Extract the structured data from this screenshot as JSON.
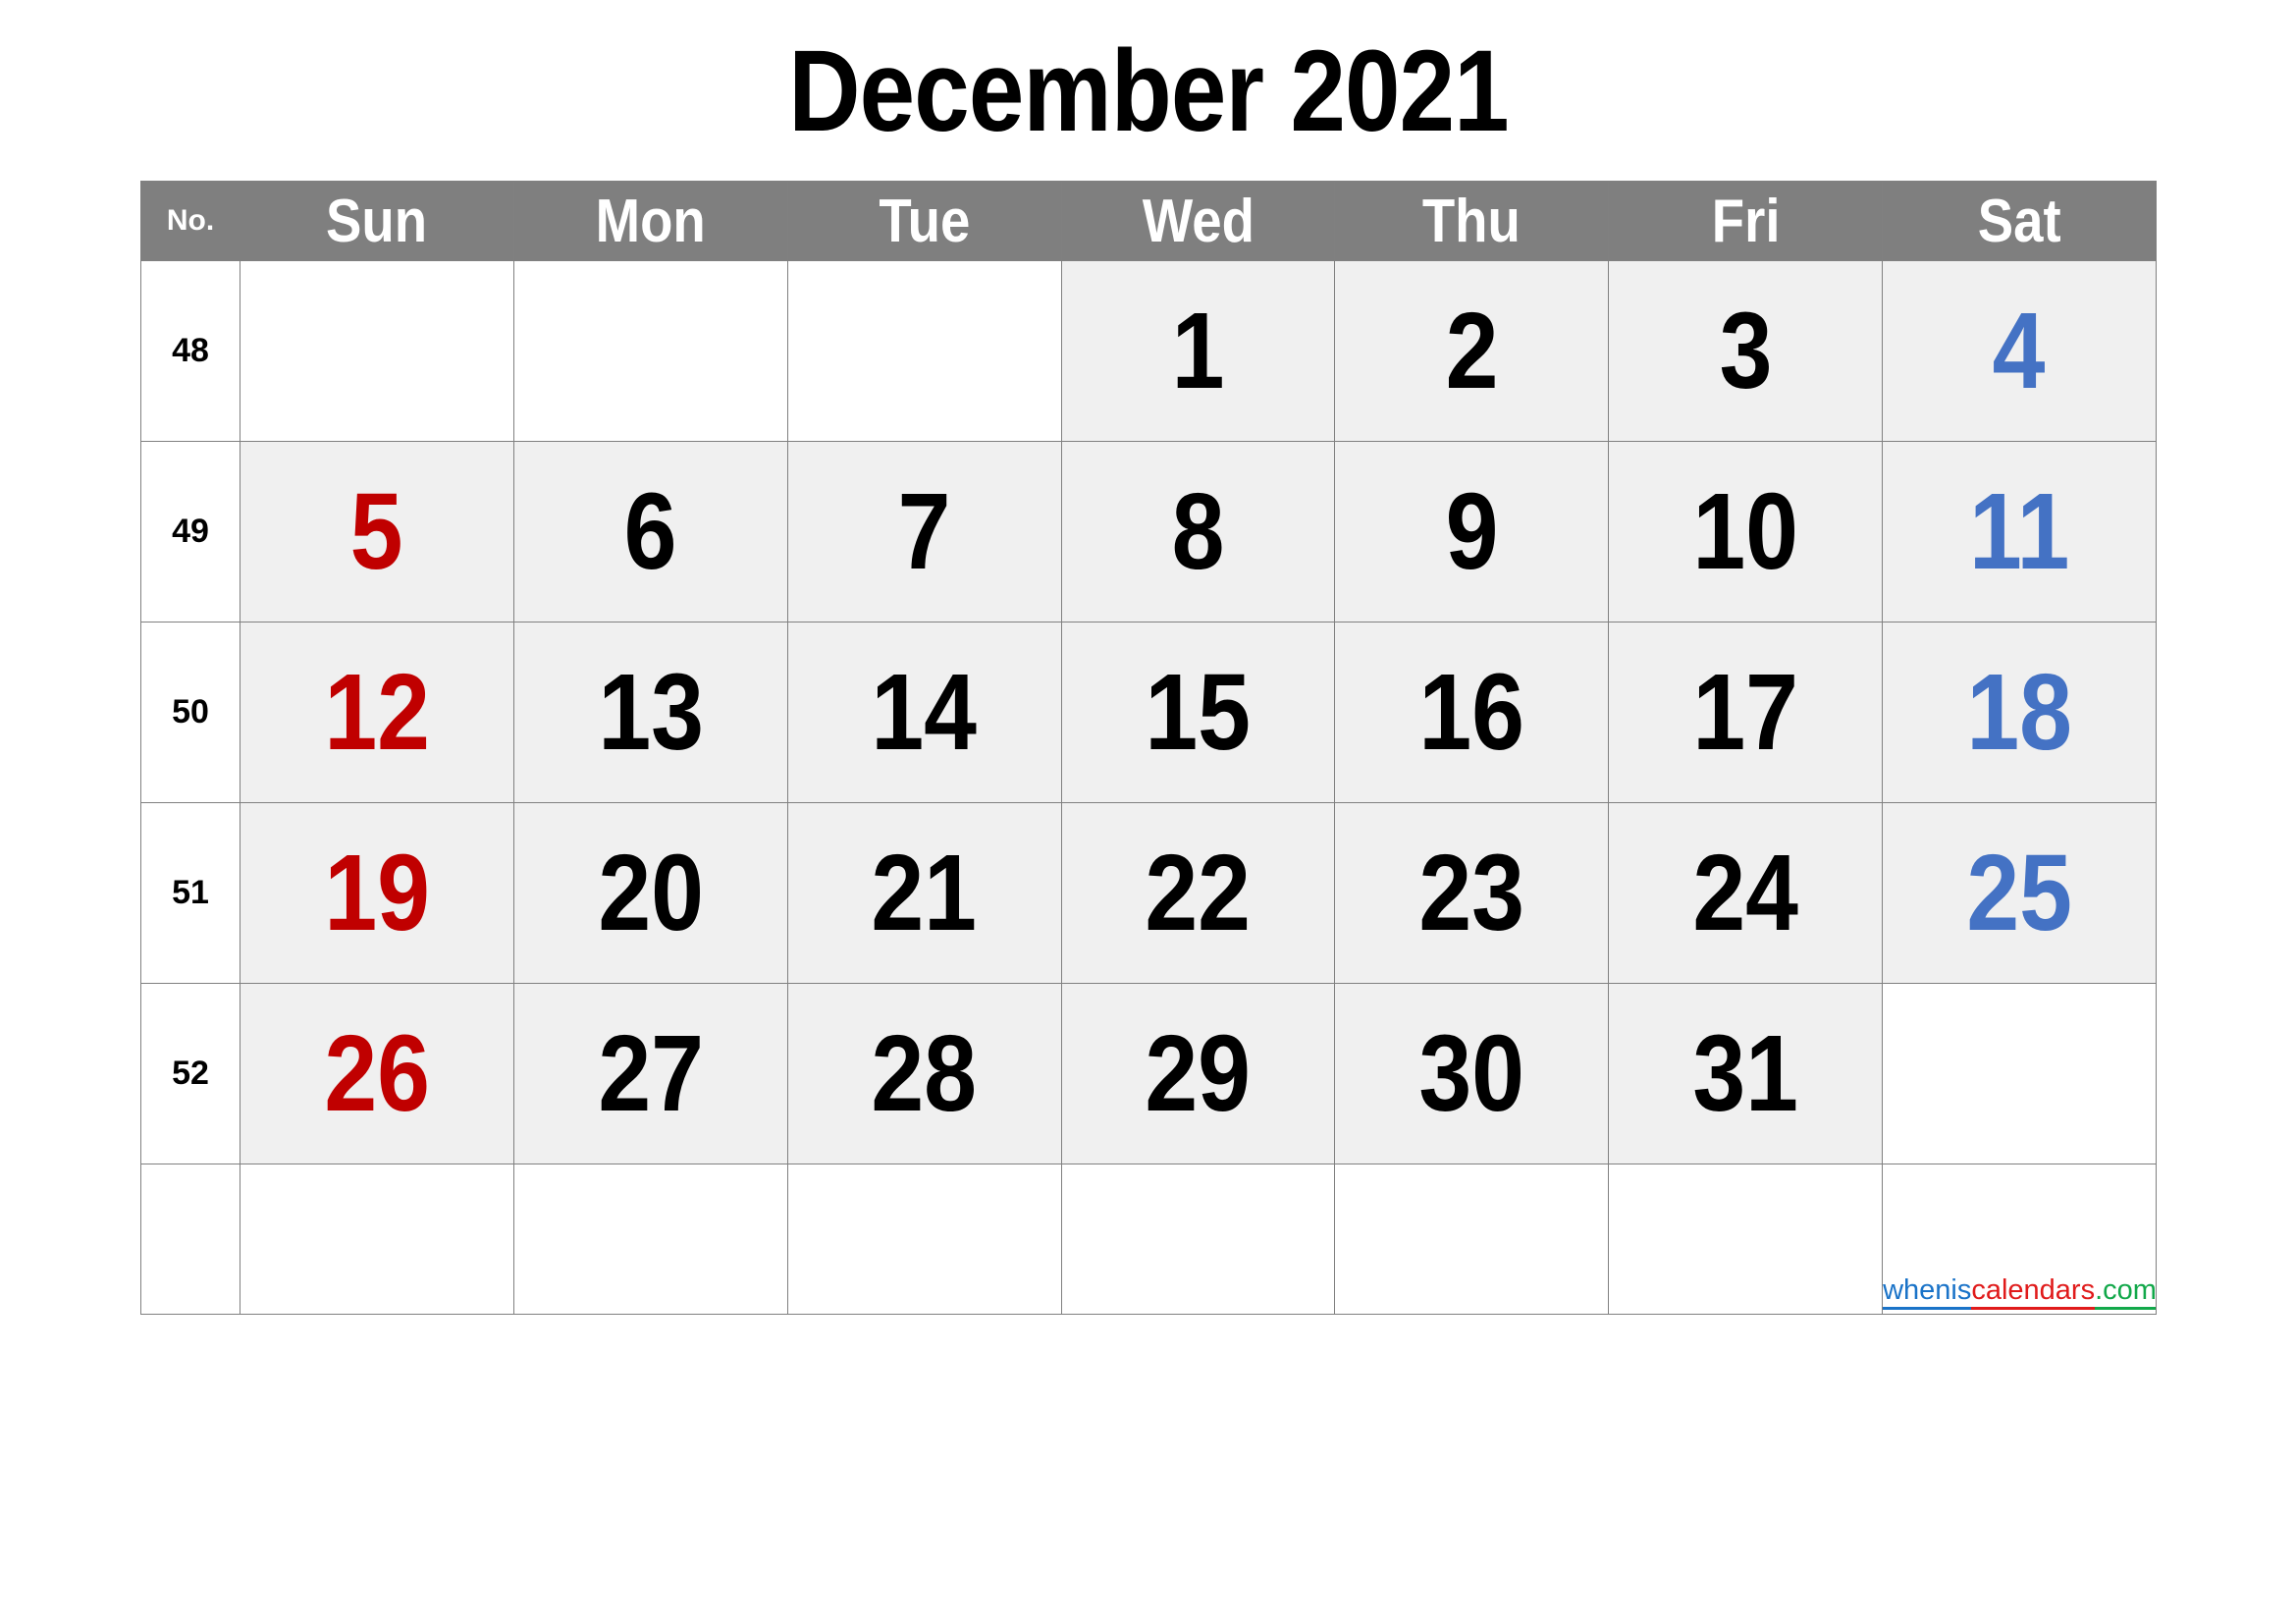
{
  "title": "December 2021",
  "table": {
    "week_col_header": "No.",
    "day_headers": [
      "Sun",
      "Mon",
      "Tue",
      "Wed",
      "Thu",
      "Fri",
      "Sat"
    ],
    "colors": {
      "header_bg": "#7f7f7f",
      "header_text": "#ffffff",
      "cell_shaded_bg": "#f0f0f0",
      "cell_empty_bg": "#ffffff",
      "border": "#808080",
      "weekday_text": "#000000",
      "sunday_text": "#c00000",
      "saturday_text": "#4472c4"
    },
    "weeks": [
      {
        "number": "48",
        "days": [
          {
            "label": "",
            "shaded": false,
            "kind": "empty"
          },
          {
            "label": "",
            "shaded": false,
            "kind": "empty"
          },
          {
            "label": "",
            "shaded": false,
            "kind": "empty"
          },
          {
            "label": "1",
            "shaded": true,
            "kind": "weekday"
          },
          {
            "label": "2",
            "shaded": true,
            "kind": "weekday"
          },
          {
            "label": "3",
            "shaded": true,
            "kind": "weekday"
          },
          {
            "label": "4",
            "shaded": true,
            "kind": "saturday"
          }
        ]
      },
      {
        "number": "49",
        "days": [
          {
            "label": "5",
            "shaded": true,
            "kind": "sunday"
          },
          {
            "label": "6",
            "shaded": true,
            "kind": "weekday"
          },
          {
            "label": "7",
            "shaded": true,
            "kind": "weekday"
          },
          {
            "label": "8",
            "shaded": true,
            "kind": "weekday"
          },
          {
            "label": "9",
            "shaded": true,
            "kind": "weekday"
          },
          {
            "label": "10",
            "shaded": true,
            "kind": "weekday"
          },
          {
            "label": "11",
            "shaded": true,
            "kind": "saturday"
          }
        ]
      },
      {
        "number": "50",
        "days": [
          {
            "label": "12",
            "shaded": true,
            "kind": "sunday"
          },
          {
            "label": "13",
            "shaded": true,
            "kind": "weekday"
          },
          {
            "label": "14",
            "shaded": true,
            "kind": "weekday"
          },
          {
            "label": "15",
            "shaded": true,
            "kind": "weekday"
          },
          {
            "label": "16",
            "shaded": true,
            "kind": "weekday"
          },
          {
            "label": "17",
            "shaded": true,
            "kind": "weekday"
          },
          {
            "label": "18",
            "shaded": true,
            "kind": "saturday"
          }
        ]
      },
      {
        "number": "51",
        "days": [
          {
            "label": "19",
            "shaded": true,
            "kind": "sunday"
          },
          {
            "label": "20",
            "shaded": true,
            "kind": "weekday"
          },
          {
            "label": "21",
            "shaded": true,
            "kind": "weekday"
          },
          {
            "label": "22",
            "shaded": true,
            "kind": "weekday"
          },
          {
            "label": "23",
            "shaded": true,
            "kind": "weekday"
          },
          {
            "label": "24",
            "shaded": true,
            "kind": "weekday"
          },
          {
            "label": "25",
            "shaded": true,
            "kind": "saturday"
          }
        ]
      },
      {
        "number": "52",
        "days": [
          {
            "label": "26",
            "shaded": true,
            "kind": "sunday"
          },
          {
            "label": "27",
            "shaded": true,
            "kind": "weekday"
          },
          {
            "label": "28",
            "shaded": true,
            "kind": "weekday"
          },
          {
            "label": "29",
            "shaded": true,
            "kind": "weekday"
          },
          {
            "label": "30",
            "shaded": true,
            "kind": "weekday"
          },
          {
            "label": "31",
            "shaded": true,
            "kind": "weekday"
          },
          {
            "label": "",
            "shaded": false,
            "kind": "empty"
          }
        ]
      },
      {
        "number": "",
        "days": [
          {
            "label": "",
            "shaded": false,
            "kind": "empty"
          },
          {
            "label": "",
            "shaded": false,
            "kind": "empty"
          },
          {
            "label": "",
            "shaded": false,
            "kind": "empty"
          },
          {
            "label": "",
            "shaded": false,
            "kind": "empty"
          },
          {
            "label": "",
            "shaded": false,
            "kind": "empty"
          },
          {
            "label": "",
            "shaded": false,
            "kind": "empty"
          },
          {
            "label": "",
            "shaded": false,
            "kind": "empty"
          }
        ]
      }
    ]
  },
  "watermark": {
    "part1": "whenis",
    "part2": "calendars",
    "part3": ".com",
    "part1_color": "#1a73c8",
    "part2_color": "#e01b1b",
    "part3_color": "#12a84a"
  }
}
